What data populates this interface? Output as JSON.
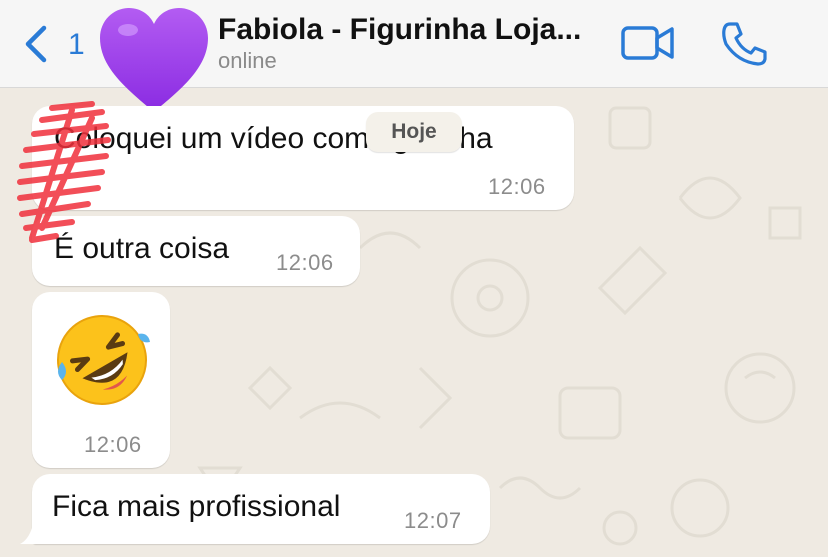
{
  "header": {
    "back_count": "1",
    "title": "Fabiola - Figurinha Loja...",
    "subtitle": "online",
    "avatar_icon": "purple-heart-icon",
    "video_icon": "video-camera-icon",
    "call_icon": "phone-icon",
    "accent_color": "#2a7bd6"
  },
  "date_separator": "Hoje",
  "messages": [
    {
      "text": "Coloquei um vídeo com figurinha",
      "time": "12:06"
    },
    {
      "text": "É outra coisa",
      "time": "12:06"
    },
    {
      "emoji": "🤣",
      "emoji_icon": "rolling-on-floor-laughing-icon",
      "time": "12:06"
    },
    {
      "text": "Fica mais profissional",
      "time": "12:07"
    }
  ]
}
